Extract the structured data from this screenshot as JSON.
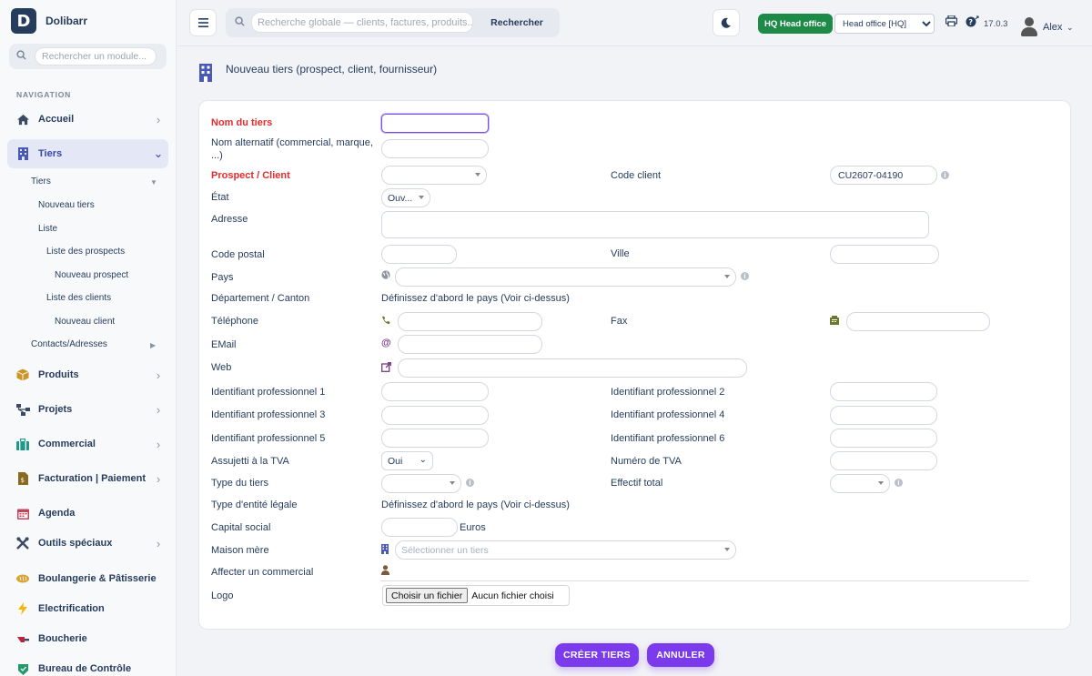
{
  "brand": {
    "logo_letter": "D",
    "name": "Dolibarr"
  },
  "sidebar": {
    "search_placeholder": "Rechercher un module...",
    "nav_label": "NAVIGATION",
    "items": [
      {
        "label": "Accueil",
        "icon": "home-icon"
      },
      {
        "label": "Tiers",
        "icon": "building-icon",
        "active": true
      },
      {
        "label": "Produits",
        "icon": "box-icon"
      },
      {
        "label": "Projets",
        "icon": "sitemap-icon"
      },
      {
        "label": "Commercial",
        "icon": "briefcase-icon"
      },
      {
        "label": "Facturation | Paiement",
        "icon": "invoice-icon"
      },
      {
        "label": "Agenda",
        "icon": "calendar-icon"
      },
      {
        "label": "Outils spéciaux",
        "icon": "tools-icon"
      },
      {
        "label": "Boulangerie & Pâtisserie",
        "icon": "bread-icon"
      },
      {
        "label": "Electrification",
        "icon": "bolt-icon"
      },
      {
        "label": "Boucherie",
        "icon": "knife-icon"
      },
      {
        "label": "Bureau de Contrôle",
        "icon": "shield-icon"
      }
    ],
    "tiers_sub": {
      "tiers": "Tiers",
      "nouveau_tiers": "Nouveau tiers",
      "liste": "Liste",
      "liste_prospects": "Liste des prospects",
      "nouveau_prospect": "Nouveau prospect",
      "liste_clients": "Liste des clients",
      "nouveau_client": "Nouveau client",
      "contacts": "Contacts/Adresses"
    }
  },
  "topbar": {
    "search_placeholder": "Recherche globale — clients, factures, produits...",
    "search_button": "Rechercher",
    "hq_badge": "HQ Head office",
    "entity_selected": "Head office [HQ]",
    "version": "17.0.3",
    "username": "Alex"
  },
  "page": {
    "title": "Nouveau tiers (prospect, client, fournisseur)"
  },
  "form": {
    "nom_tiers": "Nom du tiers",
    "nom_alt": "Nom alternatif (commercial, marque,",
    "nom_alt_2": "...)",
    "prospect_client": "Prospect / Client",
    "code_client": "Code client",
    "code_client_value": "CU2607-04190",
    "etat": "État",
    "etat_value": "Ouv...",
    "adresse": "Adresse",
    "code_postal": "Code postal",
    "ville": "Ville",
    "pays": "Pays",
    "departement": "Département / Canton",
    "departement_hint": "Définissez d'abord le pays (Voir ci-dessus)",
    "telephone": "Téléphone",
    "fax": "Fax",
    "email": "EMail",
    "web": "Web",
    "idprof1": "Identifiant professionnel 1",
    "idprof2": "Identifiant professionnel 2",
    "idprof3": "Identifiant professionnel 3",
    "idprof4": "Identifiant professionnel 4",
    "idprof5": "Identifiant professionnel 5",
    "idprof6": "Identifiant professionnel 6",
    "tva": "Assujetti à la TVA",
    "tva_value": "Oui",
    "num_tva": "Numéro de TVA",
    "type_tiers": "Type du tiers",
    "effectif": "Effectif total",
    "type_entite": "Type d'entité légale",
    "type_entite_hint": "Définissez d'abord le pays (Voir ci-dessus)",
    "capital": "Capital social",
    "capital_unit": "Euros",
    "maison_mere": "Maison mère",
    "maison_mere_placeholder": "Sélectionner un tiers",
    "commercial": "Affecter un commercial",
    "logo": "Logo",
    "file_button": "Choisir un fichier",
    "file_status": "Aucun fichier choisi"
  },
  "actions": {
    "create": "CRÉER TIERS",
    "cancel": "ANNULER"
  },
  "colors": {
    "accent": "#7c3aed",
    "required": "#e52d2d",
    "hq_green": "#1d8a47",
    "text": "#263c5c"
  }
}
